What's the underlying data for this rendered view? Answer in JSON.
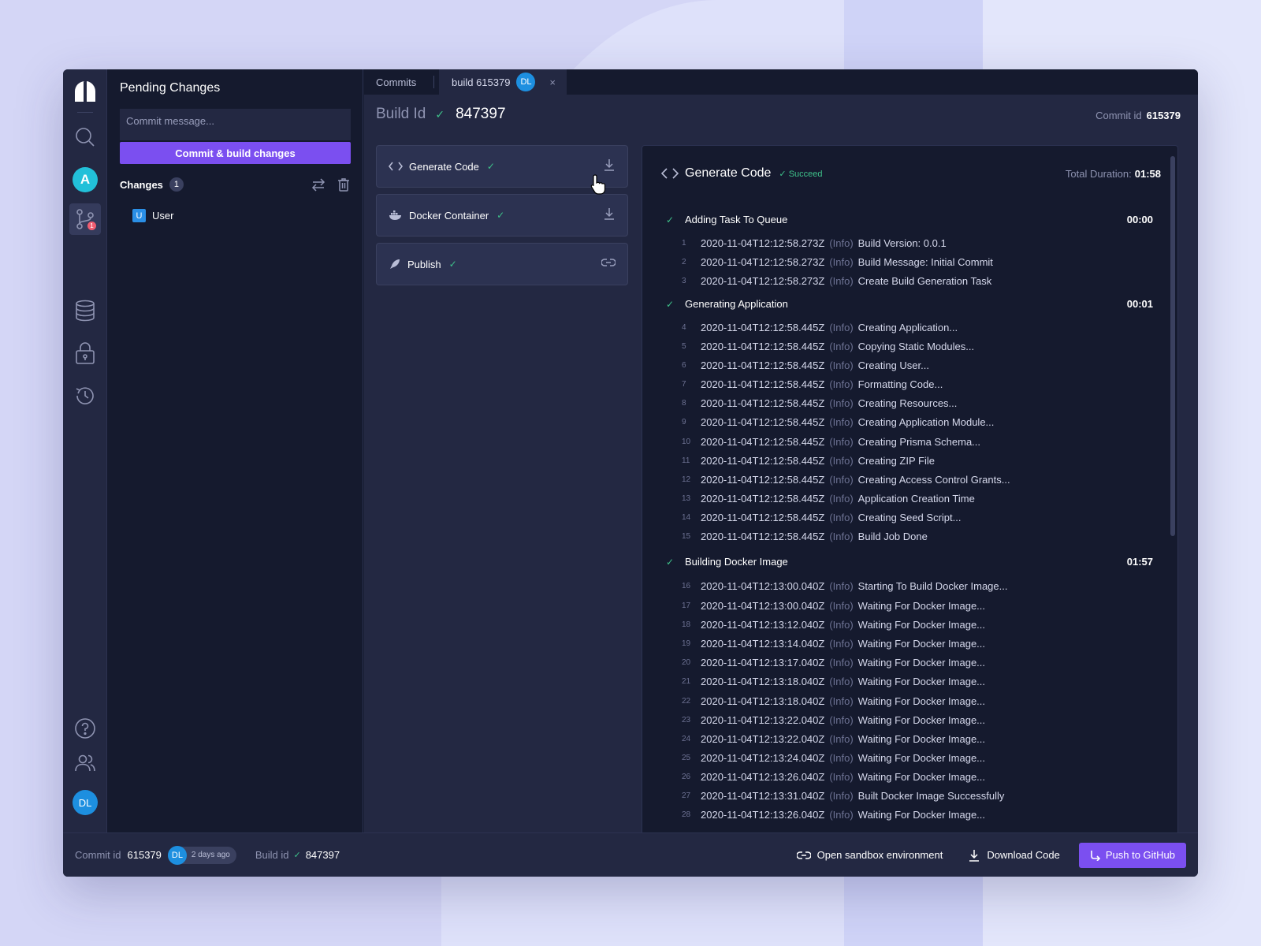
{
  "pending": {
    "title": "Pending Changes",
    "commit_placeholder": "Commit message...",
    "commit_button": "Commit & build changes",
    "changes_label": "Changes",
    "changes_count": "1",
    "items": [
      {
        "badge": "U",
        "label": "User"
      }
    ]
  },
  "rail": {
    "app_initial": "A",
    "notification_count": "1",
    "user_initials": "DL"
  },
  "tabs": {
    "commits": "Commits",
    "build": "build 615379",
    "build_avatar": "DL",
    "close": "×"
  },
  "header": {
    "build_id_label": "Build Id",
    "build_id": "847397",
    "commit_id_label": "Commit id",
    "commit_id": "615379"
  },
  "steps": [
    {
      "label": "Generate Code",
      "icon": "code-icon",
      "action": "download-icon"
    },
    {
      "label": "Docker Container",
      "icon": "docker-icon",
      "action": "download-icon"
    },
    {
      "label": "Publish",
      "icon": "rocket-icon",
      "action": "link-icon"
    }
  ],
  "log": {
    "title": "Generate Code",
    "status": "Succeed",
    "duration_label": "Total Duration:",
    "duration": "01:58",
    "sections": [
      {
        "title": "Adding Task To Queue",
        "time": "00:00"
      },
      {
        "title": "Generating Application",
        "time": "00:01"
      },
      {
        "title": "Building Docker Image",
        "time": "01:57"
      }
    ],
    "level": "(Info)",
    "lines": [
      {
        "n": "1",
        "ts": "2020-11-04T12:12:58.273Z",
        "msg": "Build Version: 0.0.1"
      },
      {
        "n": "2",
        "ts": "2020-11-04T12:12:58.273Z",
        "msg": "Build Message: Initial Commit"
      },
      {
        "n": "3",
        "ts": "2020-11-04T12:12:58.273Z",
        "msg": "Create Build Generation Task"
      },
      {
        "n": "4",
        "ts": "2020-11-04T12:12:58.445Z",
        "msg": "Creating Application..."
      },
      {
        "n": "5",
        "ts": "2020-11-04T12:12:58.445Z",
        "msg": "Copying Static Modules..."
      },
      {
        "n": "6",
        "ts": "2020-11-04T12:12:58.445Z",
        "msg": "Creating User..."
      },
      {
        "n": "7",
        "ts": "2020-11-04T12:12:58.445Z",
        "msg": "Formatting Code..."
      },
      {
        "n": "8",
        "ts": "2020-11-04T12:12:58.445Z",
        "msg": "Creating Resources..."
      },
      {
        "n": "9",
        "ts": "2020-11-04T12:12:58.445Z",
        "msg": "Creating Application Module..."
      },
      {
        "n": "10",
        "ts": "2020-11-04T12:12:58.445Z",
        "msg": "Creating Prisma Schema..."
      },
      {
        "n": "11",
        "ts": "2020-11-04T12:12:58.445Z",
        "msg": "Creating ZIP File"
      },
      {
        "n": "12",
        "ts": "2020-11-04T12:12:58.445Z",
        "msg": "Creating Access Control Grants..."
      },
      {
        "n": "13",
        "ts": "2020-11-04T12:12:58.445Z",
        "msg": " Application Creation Time"
      },
      {
        "n": "14",
        "ts": "2020-11-04T12:12:58.445Z",
        "msg": "Creating Seed Script..."
      },
      {
        "n": "15",
        "ts": "2020-11-04T12:12:58.445Z",
        "msg": "Build Job Done"
      },
      {
        "n": "16",
        "ts": "2020-11-04T12:13:00.040Z",
        "msg": " Starting To Build Docker Image..."
      },
      {
        "n": "17",
        "ts": "2020-11-04T12:13:00.040Z",
        "msg": "Waiting For Docker Image..."
      },
      {
        "n": "18",
        "ts": "2020-11-04T12:13:12.040Z",
        "msg": "Waiting For Docker Image..."
      },
      {
        "n": "19",
        "ts": "2020-11-04T12:13:14.040Z",
        "msg": "Waiting For Docker Image..."
      },
      {
        "n": "20",
        "ts": "2020-11-04T12:13:17.040Z",
        "msg": "Waiting For Docker Image..."
      },
      {
        "n": "21",
        "ts": "2020-11-04T12:13:18.040Z",
        "msg": "Waiting For Docker Image..."
      },
      {
        "n": "22",
        "ts": "2020-11-04T12:13:18.040Z",
        "msg": "Waiting For Docker Image..."
      },
      {
        "n": "23",
        "ts": "2020-11-04T12:13:22.040Z",
        "msg": "Waiting For Docker Image..."
      },
      {
        "n": "24",
        "ts": "2020-11-04T12:13:22.040Z",
        "msg": "Waiting For Docker Image..."
      },
      {
        "n": "25",
        "ts": "2020-11-04T12:13:24.040Z",
        "msg": "Waiting For Docker Image..."
      },
      {
        "n": "26",
        "ts": "2020-11-04T12:13:26.040Z",
        "msg": "Waiting For Docker Image..."
      },
      {
        "n": "27",
        "ts": "2020-11-04T12:13:31.040Z",
        "msg": "Built Docker Image Successfully"
      },
      {
        "n": "28",
        "ts": "2020-11-04T12:13:26.040Z",
        "msg": "Waiting For Docker Image..."
      }
    ]
  },
  "footer": {
    "commit_label": "Commit id",
    "commit_id": "615379",
    "avatar": "DL",
    "ago": "2 days ago",
    "build_label": "Build id",
    "build_id": "847397",
    "sandbox": "Open sandbox environment",
    "download": "Download Code",
    "push": "Push to GitHub"
  },
  "colors": {
    "accent": "#7b4ff0",
    "success": "#3ec18a",
    "panel": "#151a2e",
    "surface": "#232842"
  }
}
